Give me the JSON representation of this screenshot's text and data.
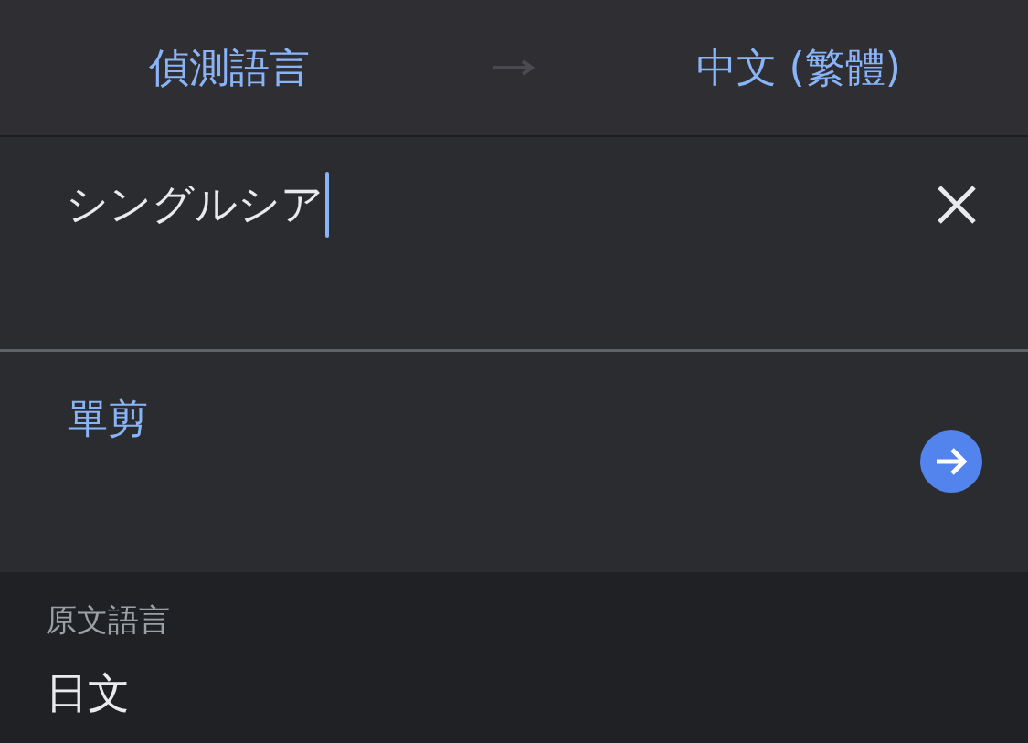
{
  "header": {
    "source_language": "偵測語言",
    "target_language": "中文 (繁體)",
    "swap_disabled": true
  },
  "input": {
    "value": "シングルシア"
  },
  "suggestion": {
    "text": "單剪"
  },
  "detected": {
    "label": "原文語言",
    "language": "日文"
  }
}
